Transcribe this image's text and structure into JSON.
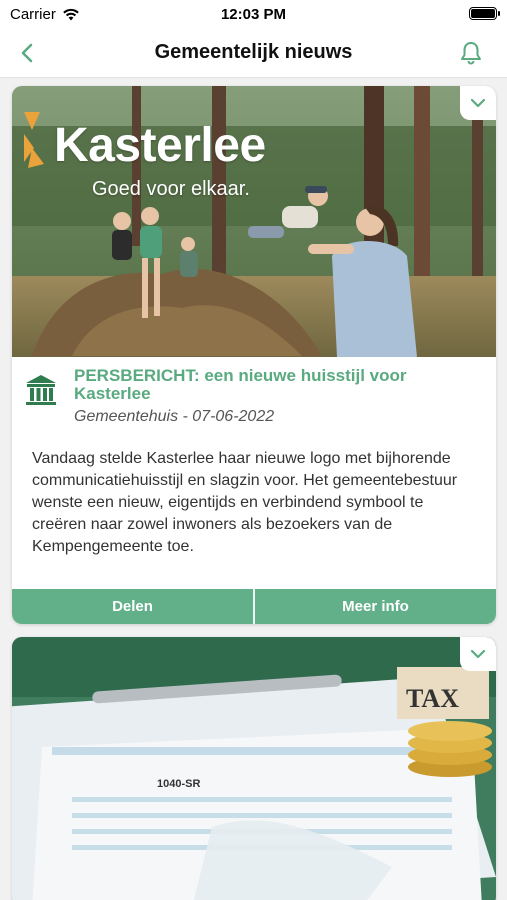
{
  "status_bar": {
    "carrier": "Carrier",
    "time": "12:03 PM"
  },
  "nav": {
    "title": "Gemeentelijk nieuws",
    "back_icon": "chevron-left-icon",
    "bell_icon": "bell-icon"
  },
  "colors": {
    "accent": "#5aaa80",
    "button_bg": "#62b08a"
  },
  "cards": [
    {
      "image_brand": "Kasterlee",
      "image_tagline": "Goed voor elkaar.",
      "icon": "town-hall-icon",
      "title": "PERSBERICHT: een nieuwe huisstijl voor Kasterlee",
      "meta": "Gemeentehuis - 07-06-2022",
      "body": "Vandaag stelde Kasterlee haar nieuwe logo met bijhorende communicatiehuisstijl en slagzin voor. Het gemeentebestuur wenste een nieuw, eigentijds en verbindend symbool te creëren naar zowel inwoners als bezoekers van de Kempengemeente toe.",
      "share_label": "Delen",
      "more_label": "Meer info"
    },
    {
      "image_text_coin": "TAX",
      "image_form_label": "1040-SR"
    }
  ]
}
